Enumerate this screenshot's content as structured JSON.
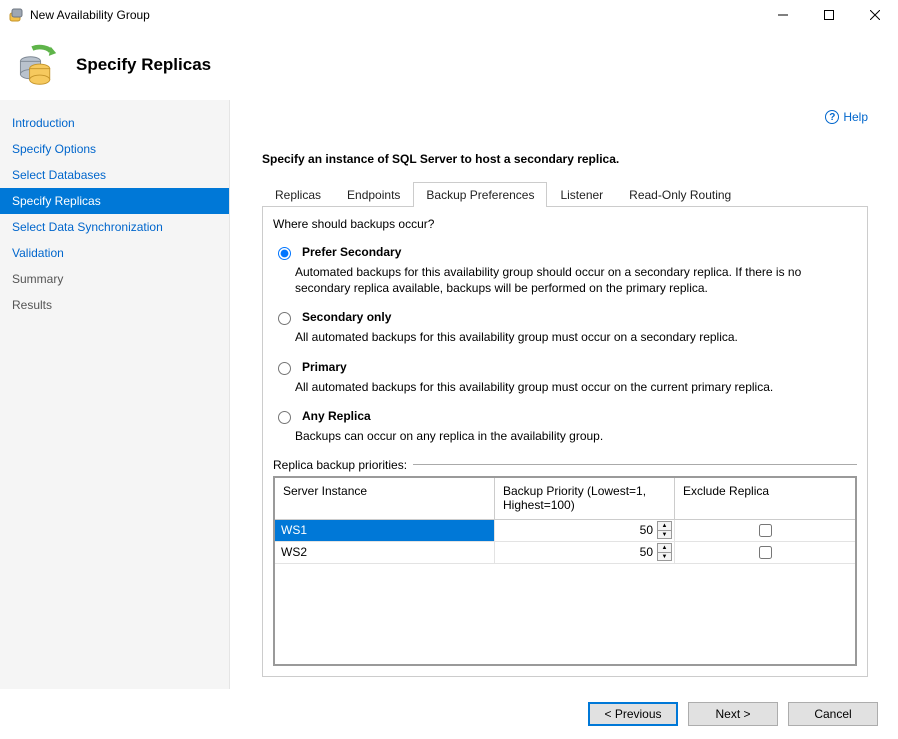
{
  "window": {
    "title": "New Availability Group"
  },
  "header": {
    "title": "Specify Replicas"
  },
  "sidebar": {
    "items": [
      {
        "label": "Introduction"
      },
      {
        "label": "Specify Options"
      },
      {
        "label": "Select Databases"
      },
      {
        "label": "Specify Replicas"
      },
      {
        "label": "Select Data Synchronization"
      },
      {
        "label": "Validation"
      },
      {
        "label": "Summary"
      },
      {
        "label": "Results"
      }
    ],
    "selected_index": 3
  },
  "help": {
    "label": "Help"
  },
  "instruction": "Specify an instance of SQL Server to host a secondary replica.",
  "tabs": [
    {
      "label": "Replicas"
    },
    {
      "label": "Endpoints"
    },
    {
      "label": "Backup Preferences"
    },
    {
      "label": "Listener"
    },
    {
      "label": "Read-Only Routing"
    }
  ],
  "active_tab_index": 2,
  "backup_prefs": {
    "question": "Where should backups occur?",
    "options": [
      {
        "label": "Prefer Secondary",
        "desc": "Automated backups for this availability group should occur on a secondary replica. If there is no secondary replica available, backups will be performed on the primary replica."
      },
      {
        "label": "Secondary only",
        "desc": "All automated backups for this availability group must occur on a secondary replica."
      },
      {
        "label": "Primary",
        "desc": "All automated backups for this availability group must occur on the current primary replica."
      },
      {
        "label": "Any Replica",
        "desc": "Backups can occur on any replica in the availability group."
      }
    ],
    "selected_option_index": 0,
    "priorities_label": "Replica backup priorities:",
    "columns": {
      "server": "Server Instance",
      "priority": "Backup Priority (Lowest=1, Highest=100)",
      "exclude": "Exclude Replica"
    },
    "rows": [
      {
        "server": "WS1",
        "priority": "50",
        "exclude": false,
        "selected": true
      },
      {
        "server": "WS2",
        "priority": "50",
        "exclude": false,
        "selected": false
      }
    ]
  },
  "buttons": {
    "previous": "< Previous",
    "next": "Next >",
    "cancel": "Cancel"
  }
}
